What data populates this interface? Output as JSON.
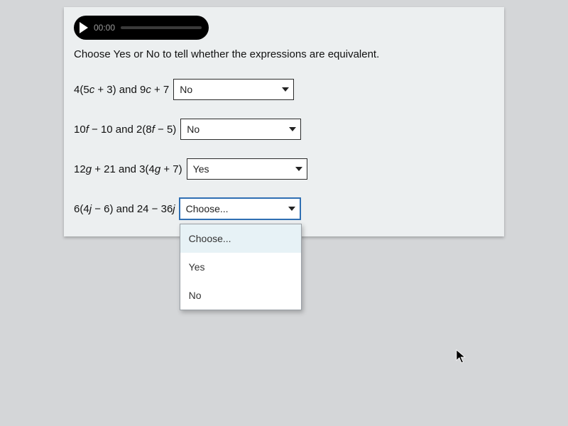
{
  "audio": {
    "time": "00:00"
  },
  "instruction": "Choose Yes or No to tell whether the expressions are equivalent.",
  "questions": [
    {
      "expr_html": "4(5<i>c</i> + 3) and 9<i>c</i> + 7",
      "value": "No"
    },
    {
      "expr_html": "10<i>f</i> − 10 and 2(8<i>f</i> − 5)",
      "value": "No"
    },
    {
      "expr_html": "12<i>g</i> + 21 and 3(4<i>g</i> + 7)",
      "value": "Yes"
    },
    {
      "expr_html": "6(4<i>j</i> − 6) and 24 − 36<i>j</i>",
      "value": "Choose..."
    }
  ],
  "dropdown": {
    "options": [
      "Choose...",
      "Yes",
      "No"
    ],
    "hover_index": 0
  }
}
